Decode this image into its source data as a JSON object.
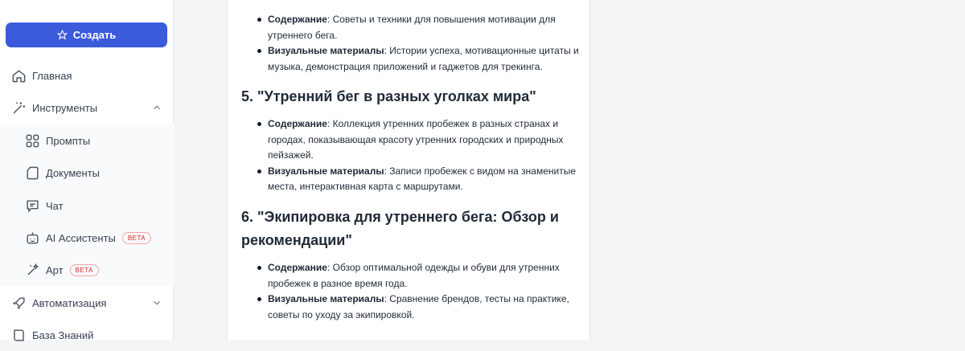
{
  "sidebar": {
    "create_label": "Создать",
    "items": [
      {
        "label": "Главная",
        "icon": "home-icon"
      },
      {
        "label": "Инструменты",
        "icon": "magic-wand-icon"
      },
      {
        "label": "Промпты",
        "icon": "grid-icon"
      },
      {
        "label": "Документы",
        "icon": "document-icon"
      },
      {
        "label": "Чат",
        "icon": "chat-icon"
      },
      {
        "label": "AI Ассистенты",
        "icon": "robot-icon",
        "badge": "BETA"
      },
      {
        "label": "Арт",
        "icon": "wand-sparkle-icon",
        "badge": "BETA"
      },
      {
        "label": "Автоматизация",
        "icon": "rocket-icon"
      },
      {
        "label": "База Знаний",
        "icon": "book-icon"
      }
    ]
  },
  "content": {
    "block4": {
      "items": [
        {
          "term": "Содержание",
          "text": "Советы и техники для повышения мотивации для утреннего бега."
        },
        {
          "term": "Визуальные материалы",
          "text": "Истории успеха, мотивационные цитаты и музыка, демонстрация приложений и гаджетов для трекинга."
        }
      ]
    },
    "block5": {
      "heading": "5. \"Утренний бег в разных уголках мира\"",
      "items": [
        {
          "term": "Содержание",
          "text": "Коллекция утренних пробежек в разных странах и городах, показывающая красоту утренних городских и природных пейзажей."
        },
        {
          "term": "Визуальные материалы",
          "text": "Записи пробежек с видом на знаменитые места, интерактивная карта с маршрутами."
        }
      ]
    },
    "block6": {
      "heading": "6. \"Экипировка для утреннего бега: Обзор и рекомендации\"",
      "items": [
        {
          "term": "Содержание",
          "text": "Обзор оптимальной одежды и обуви для утренних пробежек в разное время года."
        },
        {
          "term": "Визуальные материалы",
          "text": "Сравнение брендов, тесты на практике, советы по уходу за экипировкой."
        }
      ]
    },
    "colors": {
      "accent": "#3b5bdb",
      "beta": "#dc2626"
    }
  }
}
